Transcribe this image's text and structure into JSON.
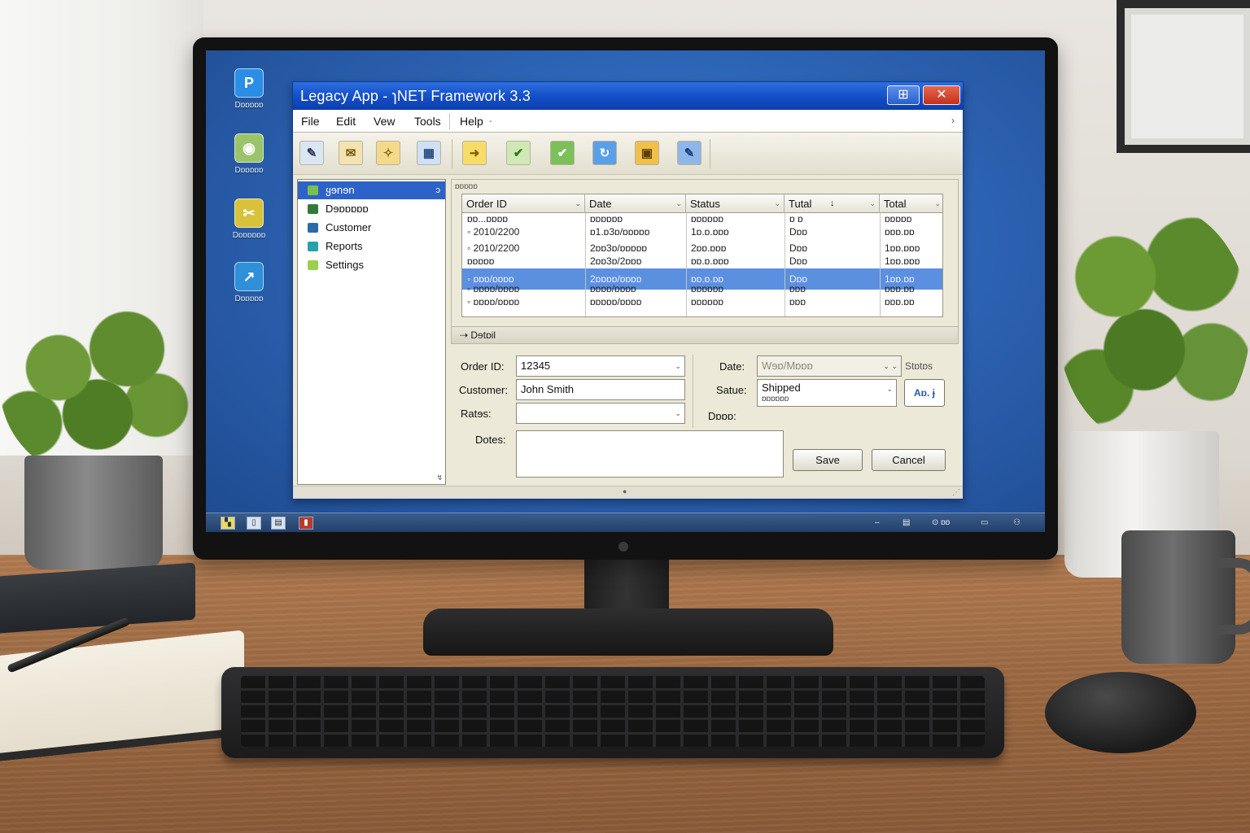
{
  "desktop": {
    "icons": [
      {
        "label": "Dɒɒɒɒɒ",
        "icon": "app-icon",
        "glyph": "P",
        "color": "#2a8ee6"
      },
      {
        "label": "Dɒɒɒɒɒ",
        "icon": "globe-icon",
        "glyph": "◉",
        "color": "#9bc46a"
      },
      {
        "label": "Dɒɒɒɒɒɒ",
        "icon": "tools-icon",
        "glyph": "✂",
        "color": "#d8c23a"
      },
      {
        "label": "Dɒɒɒɒɒ",
        "icon": "chart-icon",
        "glyph": "↗",
        "color": "#2f8fd8"
      }
    ]
  },
  "window": {
    "title": "Legacy App - ɿNET Framework 3.3",
    "maximize_icon": "maximize-icon",
    "close_icon": "close-icon"
  },
  "menu": {
    "file": "File",
    "edit": "Edit",
    "view": "Vew",
    "tools": "Tools",
    "help": "Help",
    "help_arrow": "-",
    "end_arrow": "›"
  },
  "toolbar": {
    "tools": [
      {
        "icon": "document-icon",
        "glyph": "✎",
        "color": "#dbe6f3"
      },
      {
        "icon": "mail-icon",
        "glyph": "✉",
        "color": "#f2e3b0"
      },
      {
        "icon": "folder-icon",
        "glyph": "✧",
        "color": "#f5d98a"
      },
      {
        "icon": "grid-icon",
        "glyph": "▦",
        "color": "#cfe0f5"
      },
      {
        "icon": "export-icon",
        "glyph": "➜",
        "color": "#f7dc6a"
      },
      {
        "icon": "checklist-icon",
        "glyph": "✔",
        "color": "#cfe8b5"
      },
      {
        "icon": "approve-icon",
        "glyph": "✔",
        "color": "#7cc05a"
      },
      {
        "icon": "refresh-icon",
        "glyph": "↻",
        "color": "#5aa0e6"
      },
      {
        "icon": "lock-icon",
        "glyph": "▣",
        "color": "#f0c04a"
      },
      {
        "icon": "edit-icon",
        "glyph": "✎",
        "color": "#8fb6e8"
      }
    ]
  },
  "nav": {
    "items": [
      {
        "label": "ყɘnɘn",
        "icon": "home-icon",
        "color": "#78c050",
        "selected": true,
        "end": "ↄ"
      },
      {
        "label": "Dɘɒɒɒɒɒ",
        "icon": "dashboard-icon",
        "color": "#2f7a3a"
      },
      {
        "label": "Customer",
        "icon": "customer-icon",
        "color": "#2a6aa8"
      },
      {
        "label": "Reports",
        "icon": "reports-icon",
        "color": "#2aa0a8"
      },
      {
        "label": "Settings",
        "icon": "settings-icon",
        "color": "#9ad050"
      }
    ],
    "corner": "↯"
  },
  "grid": {
    "caption": "ɒɒɒɒɒ",
    "columns": [
      "Order ID",
      "Date",
      "Status",
      "Tutal",
      "Total"
    ],
    "total_arrow": "↓",
    "rows": [
      [
        "ɒɒ...ɒɒɒɒ",
        "ɒɒɒɒɒɒ",
        "ɒɒɒɒɒɒ",
        "ɒ ɒ",
        "ɒɒɒɒɒ"
      ],
      [
        "◦ 2010/2200",
        "ɒ1.ɒ3ɒ/ɒɒɒɒɒ",
        "1ɒ.ɒ.ɒɒɒ",
        "Dɒɒ",
        "ɒɒɒ.ɒɒ"
      ],
      [
        "◦ 2010/2200",
        "2ɒɒ3ɒ/ɒɒɒɒɒ",
        "2ɒɒ.ɒɒɒ",
        "Dɒɒ",
        "1ɒɒ.ɒɒɒ"
      ],
      [
        "ɒɒɒɒɒ",
        "2ɒɒ3ɒ/2ɒɒɒ",
        "ɒɒ.ɒ.ɒɒɒ",
        "Dɒɒ",
        "1ɒɒ.ɒɒɒ"
      ],
      [
        "◦ ɒɒɒ/ɒɒɒɒ",
        "2ɒɒɒɒ/ɒɒɒɒ",
        "ɒɒ.ɒ.ɒɒ",
        "Dɒɒ",
        "1ɒɒ.ɒɒ"
      ],
      [
        "◦ ɒɒɒɒ/ɒɒɒɒ",
        "ɒɒɒɒ/ɒɒɒɒ",
        "ɒɒɒɒɒɒ",
        "ɒɒɒ",
        "ɒɒɒ.ɒɒ"
      ],
      [
        "◦ ɒɒɒɒ/ɒɒɒɒ",
        "ɒɒɒɒɒ/ɒɒɒɒ",
        "ɒɒɒɒɒɒ",
        "ɒɒɒ",
        "ɒɒɒ.ɒɒ"
      ]
    ]
  },
  "details": {
    "header": "Dɘtɒil",
    "order_id_label": "Order ID:",
    "order_id_value": "12345",
    "customer_label": "Customer:",
    "customer_value": "John Smith",
    "rates_label": "Ratɘs:",
    "rates_value": "",
    "notes_label": "Dotes:",
    "notes_value": "",
    "date_label": "Date:",
    "date_value": "Wɘɒ/Mɒɒɒ",
    "date_side": "Stɒtɒs",
    "status_label": "Satue:",
    "status_value": "Shipped",
    "status_sub": "ɒɒɒɒɒɒ",
    "status_button": "Aɒ. ɉ",
    "notes_right_label": "Dɒɒɒ:",
    "save": "Save",
    "cancel": "Cancel"
  },
  "taskbar": {
    "items": [
      {
        "icon": "start-icon",
        "glyph": "▚"
      },
      {
        "icon": "window-icon",
        "glyph": "▯"
      },
      {
        "icon": "list-icon",
        "glyph": "▤"
      },
      {
        "icon": "app-running-icon",
        "glyph": "▮"
      }
    ],
    "tray": [
      {
        "icon": "network-icon",
        "glyph": "▤"
      },
      {
        "icon": "clock-icon",
        "glyph": "⊙ ɒɒ"
      },
      {
        "icon": "monitor-icon",
        "glyph": "▭"
      },
      {
        "icon": "users-icon",
        "glyph": "⚇"
      }
    ]
  }
}
